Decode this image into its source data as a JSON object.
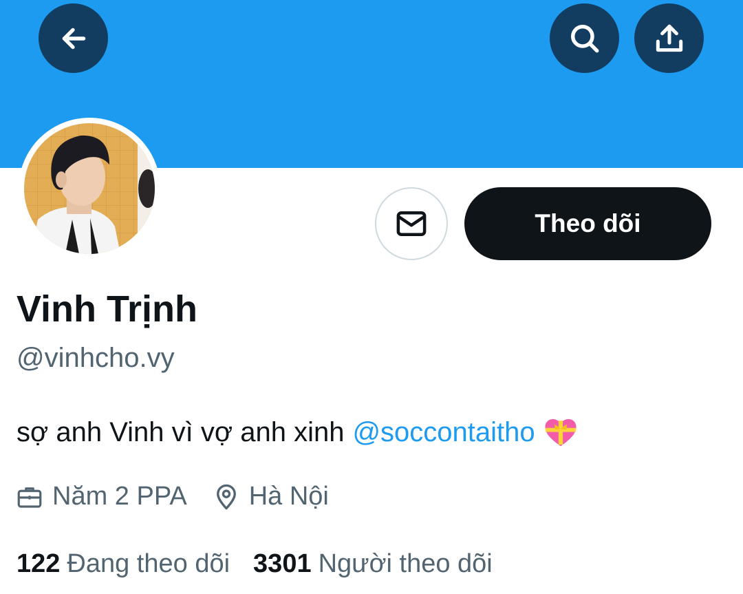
{
  "colors": {
    "banner": "#1d9bf0",
    "primary_text": "#0f1419",
    "secondary_text": "#536471",
    "link": "#1d9bf0",
    "follow_button_bg": "#0f1419"
  },
  "header": {
    "back_icon": "arrow-left-icon",
    "search_icon": "search-icon",
    "share_icon": "share-upload-icon"
  },
  "profile": {
    "display_name": "Vinh Trịnh",
    "handle": "@vinhcho.vy",
    "bio_text": "sợ anh Vinh vì vợ anh xinh",
    "bio_mention": "@soccontaitho",
    "bio_emoji": "heart-with-ribbon-icon",
    "occupation": "Năm 2 PPA",
    "location": "Hà Nội"
  },
  "actions": {
    "message_icon": "envelope-icon",
    "follow_label": "Theo dõi"
  },
  "stats": {
    "following_count": "122",
    "following_label": "Đang theo dõi",
    "followers_count": "3301",
    "followers_label": "Người theo dõi"
  }
}
